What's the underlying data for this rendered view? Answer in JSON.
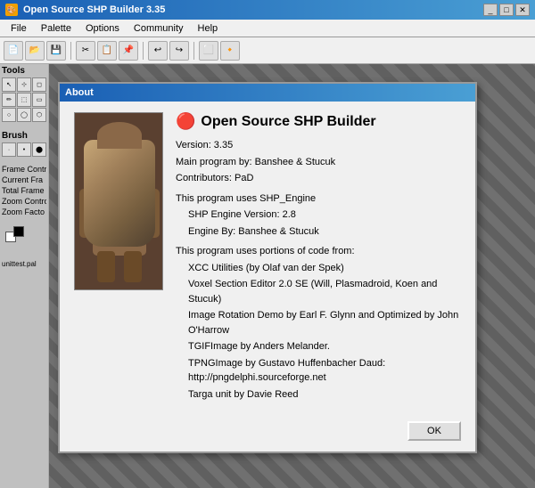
{
  "window": {
    "title": "Open Source SHP Builder 3.35",
    "icon": "🎨"
  },
  "menu": {
    "items": [
      "File",
      "Palette",
      "Options",
      "Community",
      "Help"
    ]
  },
  "toolbar": {
    "buttons": [
      "new",
      "open",
      "save",
      "cut",
      "copy",
      "paste",
      "undo",
      "redo",
      "export",
      "import"
    ]
  },
  "sidebar": {
    "tools_label": "Tools",
    "brush_label": "Brush",
    "frame_labels": [
      "Frame Contro",
      "Current Fra",
      "Total Frame",
      "Zoom Contro",
      "Zoom Facto"
    ],
    "palette_file": "unittest.pal"
  },
  "about_dialog": {
    "title": "About",
    "app_icon": "🔴",
    "app_title": "Open Source SHP Builder",
    "version_line": "Version: 3.35",
    "main_program": "Main program by: Banshee & Stucuk",
    "contributors": "Contributors: PaD",
    "shp_engine_intro": "This program uses SHP_Engine",
    "shp_version": "SHP Engine Version: 2.8",
    "engine_by": "Engine By: Banshee & Stucuk",
    "code_intro": "This program uses portions of code from:",
    "xcc": "XCC Utilities (by Olaf van der Spek)",
    "voxel": "Voxel Section Editor 2.0 SE (Will, Plasmadroid, Koen and Stucuk)",
    "image_rotation": "Image Rotation Demo by Earl F. Glynn and Optimized by John O'Harrow",
    "tgif": "TGIFImage by Anders Melander.",
    "png": "TPNGImage by Gustavo Huffenbacher Daud: http://pngdelphi.sourceforge.net",
    "targa": "Targa unit by Davie Reed",
    "ok_button": "OK"
  },
  "title_controls": {
    "minimize": "_",
    "maximize": "□",
    "close": "✕"
  }
}
